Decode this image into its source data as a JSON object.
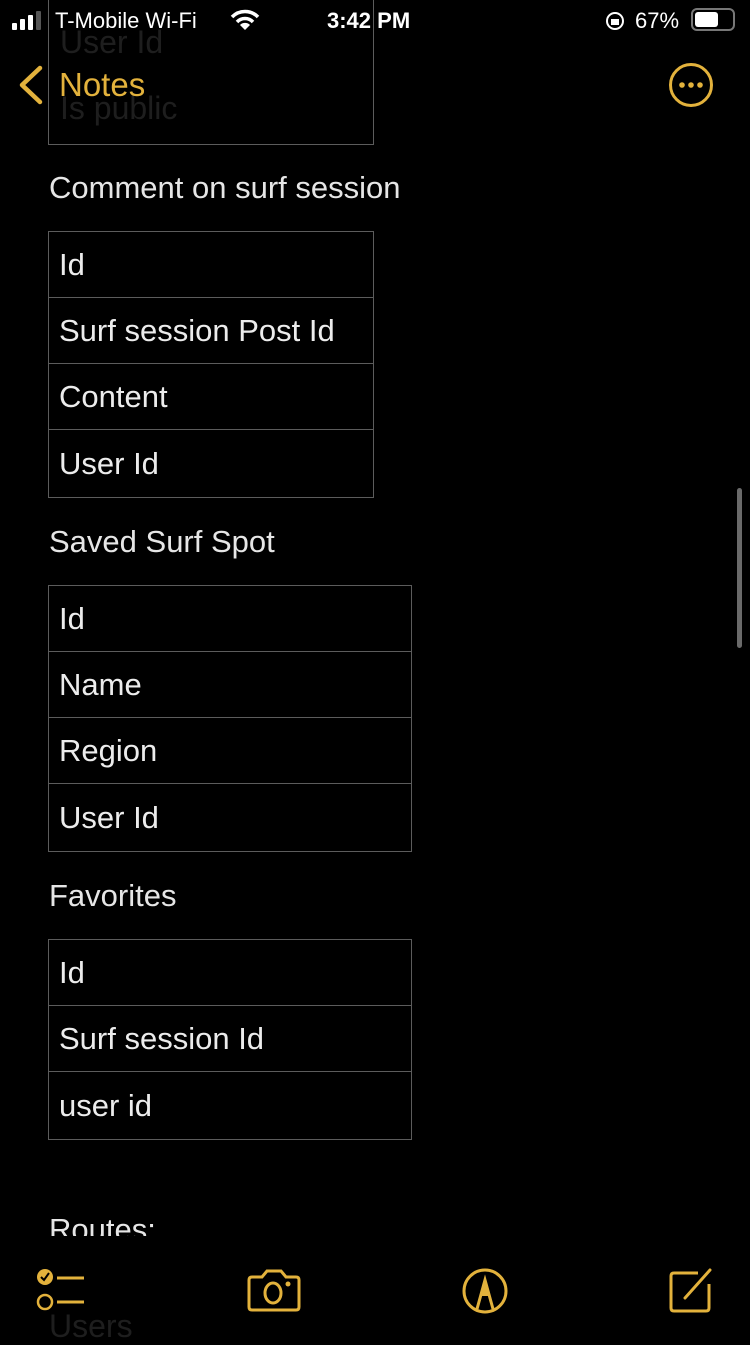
{
  "status_bar": {
    "carrier": "T-Mobile Wi-Fi",
    "time": "3:42 PM",
    "battery": "67%"
  },
  "nav": {
    "back_label": "Notes",
    "more_icon": "ellipsis-circle-icon"
  },
  "accent_color": "#e3b23c",
  "note": {
    "faded_top": [
      "User Id",
      "Is public"
    ],
    "sections": [
      {
        "title": "Comment on surf session",
        "rows": [
          "Id",
          "Surf session Post Id",
          "Content",
          "User Id"
        ]
      },
      {
        "title": "Saved Surf Spot",
        "rows": [
          "Id",
          "Name",
          "Region",
          "User Id"
        ]
      },
      {
        "title": "Favorites",
        "rows": [
          "Id",
          "Surf session Id",
          "user id"
        ]
      }
    ],
    "routes_heading": "Routes:",
    "faded_bottom": "Users"
  },
  "toolbar": {
    "icons": [
      "checklist-icon",
      "camera-icon",
      "markup-icon",
      "compose-icon"
    ]
  }
}
